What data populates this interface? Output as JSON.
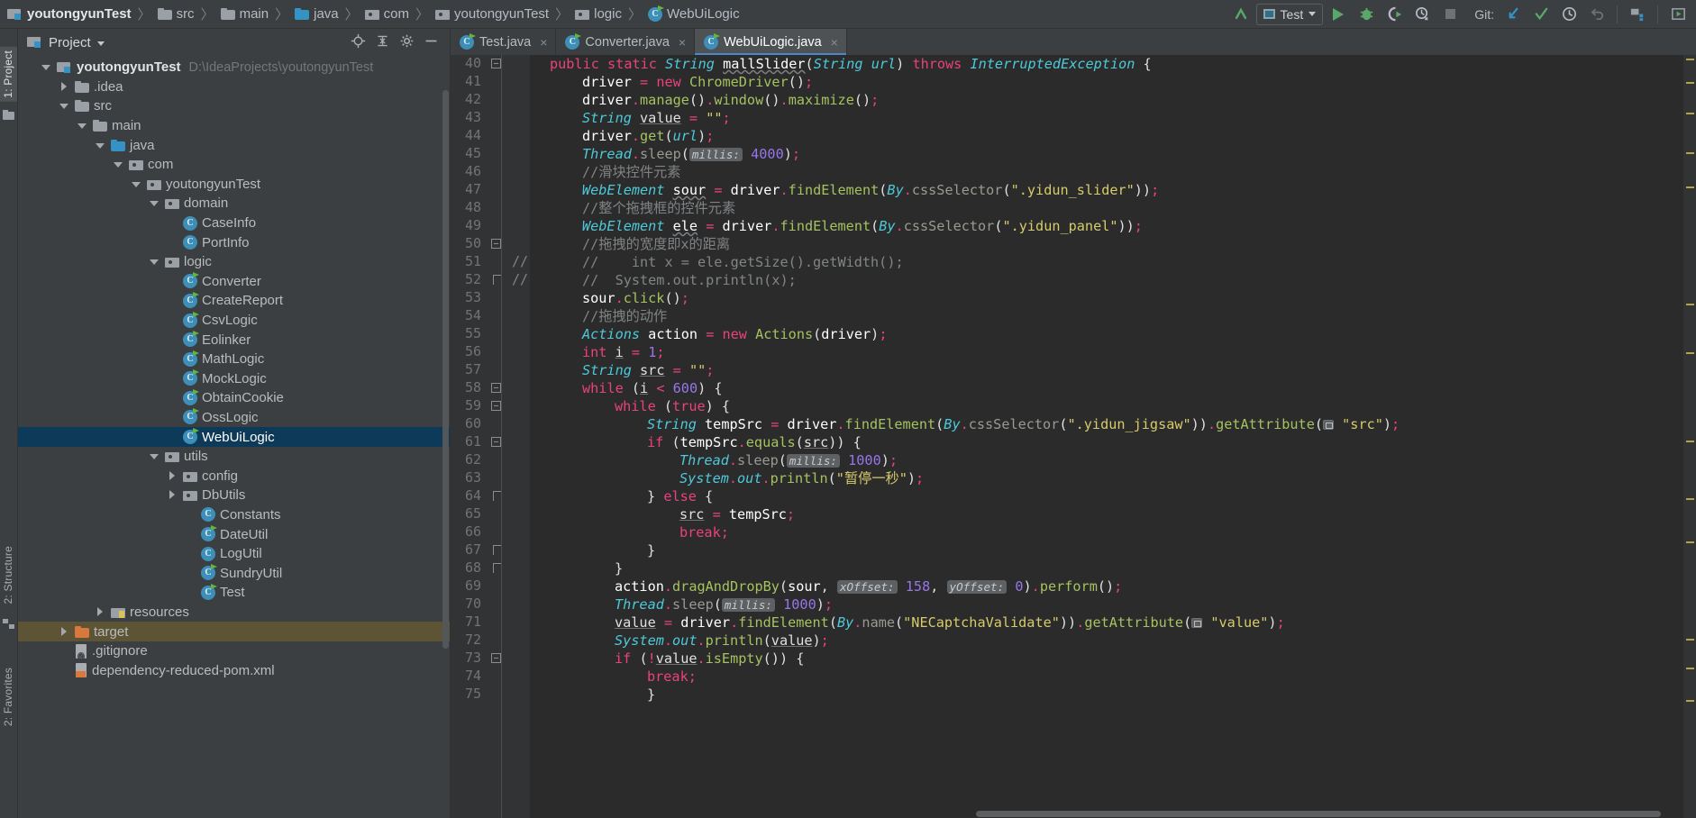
{
  "breadcrumb": {
    "items": [
      {
        "label": "youtongyunTest",
        "icon": "project-icon",
        "kind": "project"
      },
      {
        "label": "src",
        "icon": "folder-icon",
        "kind": "folder"
      },
      {
        "label": "main",
        "icon": "folder-icon",
        "kind": "folder"
      },
      {
        "label": "java",
        "icon": "source-folder-icon",
        "kind": "source"
      },
      {
        "label": "com",
        "icon": "package-icon",
        "kind": "package"
      },
      {
        "label": "youtongyunTest",
        "icon": "package-icon",
        "kind": "package"
      },
      {
        "label": "logic",
        "icon": "package-icon",
        "kind": "package"
      },
      {
        "label": "WebUiLogic",
        "icon": "java-class-icon",
        "kind": "class"
      }
    ],
    "separator": "〉"
  },
  "toolbar": {
    "back_arrow": "back-arrow-icon",
    "run_config": "Test",
    "run": "run-icon",
    "debug": "debug-icon",
    "run_coverage": "run-with-coverage-icon",
    "profile": "profiler-icon",
    "stop": "stop-icon",
    "git_label": "Git:",
    "git_update": "update-project-icon",
    "git_commit": "commit-icon",
    "git_history": "history-icon",
    "git_rollback": "rollback-icon",
    "project_structure": "project-structure-icon",
    "search_everywhere": "select-opened-file-icon"
  },
  "left_strip": {
    "project_tab": "1: Project",
    "structure_tab": "2: Structure",
    "favorites_tab": "2: Favorites"
  },
  "project_panel": {
    "title": "Project",
    "actions": [
      "locate-icon",
      "collapse-all-icon",
      "settings-icon",
      "hide-icon"
    ],
    "tree": [
      {
        "depth": 0,
        "arrow": "down",
        "icon": "project-icon",
        "label": "youtongyunTest",
        "path": "D:\\IdeaProjects\\youtongyunTest",
        "bold": true
      },
      {
        "depth": 1,
        "arrow": "right",
        "icon": "folder-icon",
        "label": ".idea"
      },
      {
        "depth": 1,
        "arrow": "down",
        "icon": "folder-icon",
        "label": "src"
      },
      {
        "depth": 2,
        "arrow": "down",
        "icon": "folder-icon",
        "label": "main"
      },
      {
        "depth": 3,
        "arrow": "down",
        "icon": "source-folder-icon",
        "label": "java"
      },
      {
        "depth": 4,
        "arrow": "down",
        "icon": "package-icon",
        "label": "com"
      },
      {
        "depth": 5,
        "arrow": "down",
        "icon": "package-icon",
        "label": "youtongyunTest"
      },
      {
        "depth": 6,
        "arrow": "down",
        "icon": "package-icon",
        "label": "domain"
      },
      {
        "depth": 7,
        "arrow": "none",
        "icon": "java-class-icon",
        "label": "CaseInfo"
      },
      {
        "depth": 7,
        "arrow": "none",
        "icon": "java-class-icon",
        "label": "PortInfo"
      },
      {
        "depth": 6,
        "arrow": "down",
        "icon": "package-icon",
        "label": "logic"
      },
      {
        "depth": 7,
        "arrow": "none",
        "icon": "java-class-runnable-icon",
        "label": "Converter"
      },
      {
        "depth": 7,
        "arrow": "none",
        "icon": "java-class-runnable-icon",
        "label": "CreateReport"
      },
      {
        "depth": 7,
        "arrow": "none",
        "icon": "java-class-runnable-icon",
        "label": "CsvLogic"
      },
      {
        "depth": 7,
        "arrow": "none",
        "icon": "java-class-runnable-icon",
        "label": "Eolinker"
      },
      {
        "depth": 7,
        "arrow": "none",
        "icon": "java-class-runnable-icon",
        "label": "MathLogic"
      },
      {
        "depth": 7,
        "arrow": "none",
        "icon": "java-class-runnable-icon",
        "label": "MockLogic"
      },
      {
        "depth": 7,
        "arrow": "none",
        "icon": "java-class-runnable-icon",
        "label": "ObtainCookie"
      },
      {
        "depth": 7,
        "arrow": "none",
        "icon": "java-class-runnable-icon",
        "label": "OssLogic"
      },
      {
        "depth": 7,
        "arrow": "none",
        "icon": "java-class-runnable-icon",
        "label": "WebUiLogic",
        "selected": true
      },
      {
        "depth": 6,
        "arrow": "down",
        "icon": "package-icon",
        "label": "utils"
      },
      {
        "depth": 7,
        "arrow": "right",
        "icon": "package-icon",
        "label": "config"
      },
      {
        "depth": 7,
        "arrow": "right",
        "icon": "package-icon",
        "label": "DbUtils"
      },
      {
        "depth": 8,
        "arrow": "none",
        "icon": "java-class-icon",
        "label": "Constants"
      },
      {
        "depth": 8,
        "arrow": "none",
        "icon": "java-class-runnable-icon",
        "label": "DateUtil"
      },
      {
        "depth": 8,
        "arrow": "none",
        "icon": "java-class-icon",
        "label": "LogUtil"
      },
      {
        "depth": 8,
        "arrow": "none",
        "icon": "java-class-runnable-icon",
        "label": "SundryUtil"
      },
      {
        "depth": 8,
        "arrow": "none",
        "icon": "java-class-runnable-icon",
        "label": "Test"
      },
      {
        "depth": 3,
        "arrow": "right",
        "icon": "resource-folder-icon",
        "label": "resources"
      },
      {
        "depth": 1,
        "arrow": "right",
        "icon": "target-folder-icon",
        "label": "target",
        "highlight": true
      },
      {
        "depth": 1,
        "arrow": "none",
        "icon": "gitignore-file-icon",
        "label": ".gitignore"
      },
      {
        "depth": 1,
        "arrow": "none",
        "icon": "xml-file-icon",
        "label": "dependency-reduced-pom.xml"
      }
    ]
  },
  "editor": {
    "tabs": [
      {
        "label": "Test.java",
        "icon": "java-class-runnable-icon",
        "active": false,
        "close": "×"
      },
      {
        "label": "Converter.java",
        "icon": "java-class-runnable-icon",
        "active": false,
        "close": "×"
      },
      {
        "label": "WebUiLogic.java",
        "icon": "java-class-runnable-icon",
        "active": true,
        "close": "×"
      }
    ],
    "first_line_number": 40,
    "lines": [
      {
        "n": 40,
        "fold": "minus",
        "indent": 0,
        "html": "<span class=\"kwp\">public</span> <span class=\"kwp\">static</span> <span class=\"ty\">String</span> <span class=\"ident squig\">mallSlider</span><span class=\"punc\">(</span><span class=\"ty\">String</span> <span class=\"ty\">url</span><span class=\"punc\">)</span> <span class=\"kwp\">throws</span> <span class=\"ty\">InterruptedException</span> <span class=\"punc\">{</span>"
      },
      {
        "n": 41,
        "fold": "",
        "indent": 1,
        "html": "<span class=\"ident\">driver</span> <span class=\"semi\">=</span> <span class=\"kwp\">new</span> <span class=\"mth\">ChromeDriver</span><span class=\"punc\">()</span><span class=\"semi\">;</span>"
      },
      {
        "n": 42,
        "fold": "",
        "indent": 1,
        "html": "<span class=\"ident\">driver</span><span class=\"dot\">.</span><span class=\"mth\">manage</span><span class=\"punc\">()</span><span class=\"dot\">.</span><span class=\"mth\">window</span><span class=\"punc\">()</span><span class=\"dot\">.</span><span class=\"mth\">maximize</span><span class=\"punc\">()</span><span class=\"semi\">;</span>"
      },
      {
        "n": 43,
        "fold": "",
        "indent": 1,
        "html": "<span class=\"ty\">String</span> <span class=\"fld\">value</span> <span class=\"semi\">=</span> <span class=\"str\">\"\"</span><span class=\"semi\">;</span>"
      },
      {
        "n": 44,
        "fold": "",
        "indent": 1,
        "html": "<span class=\"ident\">driver</span><span class=\"dot\">.</span><span class=\"mth\">get</span><span class=\"punc\">(</span><span class=\"ty\">url</span><span class=\"punc\">)</span><span class=\"semi\">;</span>"
      },
      {
        "n": 45,
        "fold": "",
        "indent": 1,
        "html": "<span class=\"ty\">Thread</span><span class=\"dot\">.</span><span class=\"mthg\">sleep</span><span class=\"punc\">(</span><span class=\"param\">millis:</span> <span class=\"num\">4000</span><span class=\"punc\">)</span><span class=\"semi\">;</span>"
      },
      {
        "n": 46,
        "fold": "",
        "indent": 1,
        "html": "<span class=\"cmt\">//滑块控件元素</span>"
      },
      {
        "n": 47,
        "fold": "",
        "indent": 1,
        "html": "<span class=\"ty\">WebElement</span> <span class=\"ident squig\">sour</span> <span class=\"semi\">=</span> <span class=\"ident\">driver</span><span class=\"dot\">.</span><span class=\"mth\">findElement</span><span class=\"punc\">(</span><span class=\"ty\">By</span><span class=\"dot\">.</span><span class=\"mthg\">cssSelector</span><span class=\"punc\">(</span><span class=\"str\">\".yidun_slider\"</span><span class=\"punc\">))</span><span class=\"semi\">;</span>"
      },
      {
        "n": 48,
        "fold": "",
        "indent": 1,
        "html": "<span class=\"cmt\">//整个拖拽框的控件元素</span>"
      },
      {
        "n": 49,
        "fold": "",
        "indent": 1,
        "html": "<span class=\"ty\">WebElement</span> <span class=\"ident squig\">ele</span> <span class=\"semi\">=</span> <span class=\"ident\">driver</span><span class=\"dot\">.</span><span class=\"mth\">findElement</span><span class=\"punc\">(</span><span class=\"ty\">By</span><span class=\"dot\">.</span><span class=\"mthg\">cssSelector</span><span class=\"punc\">(</span><span class=\"str\">\".yidun_panel\"</span><span class=\"punc\">))</span><span class=\"semi\">;</span>"
      },
      {
        "n": 50,
        "fold": "minus",
        "indent": 1,
        "html": "<span class=\"cmt\">//拖拽的宽度即x的距离</span>"
      },
      {
        "n": 51,
        "fold": "",
        "indent": 1,
        "prefix": "//",
        "html": "<span class=\"cmtline\">    int x = ele.getSize().getWidth();</span>"
      },
      {
        "n": 52,
        "fold": "end",
        "indent": 1,
        "prefix": "//",
        "html": "<span class=\"cmtline\">  System.out.println(x);</span>"
      },
      {
        "n": 53,
        "fold": "",
        "indent": 1,
        "html": "<span class=\"ident\">sour</span><span class=\"dot\">.</span><span class=\"mth\">click</span><span class=\"punc\">()</span><span class=\"semi\">;</span>"
      },
      {
        "n": 54,
        "fold": "",
        "indent": 1,
        "html": "<span class=\"cmt\">//拖拽的动作</span>"
      },
      {
        "n": 55,
        "fold": "",
        "indent": 1,
        "html": "<span class=\"ty\">Actions</span> <span class=\"ident\">action</span> <span class=\"semi\">=</span> <span class=\"kwp\">new</span> <span class=\"mth\">Actions</span><span class=\"punc\">(</span><span class=\"ident\">driver</span><span class=\"punc\">)</span><span class=\"semi\">;</span>"
      },
      {
        "n": 56,
        "fold": "",
        "indent": 1,
        "html": "<span class=\"kwp\">int</span> <span class=\"fld\">i</span> <span class=\"semi\">=</span> <span class=\"num\">1</span><span class=\"semi\">;</span>"
      },
      {
        "n": 57,
        "fold": "",
        "indent": 1,
        "html": "<span class=\"ty\">String</span> <span class=\"fld\">src</span> <span class=\"semi\">=</span> <span class=\"str\">\"\"</span><span class=\"semi\">;</span>"
      },
      {
        "n": 58,
        "fold": "minus",
        "indent": 1,
        "html": "<span class=\"kwp\">while</span> <span class=\"punc\">(</span><span class=\"fld\">i</span> <span class=\"semi\">&lt;</span> <span class=\"num\">600</span><span class=\"punc\">) {</span>"
      },
      {
        "n": 59,
        "fold": "minus",
        "indent": 2,
        "html": "<span class=\"kwp\">while</span> <span class=\"punc\">(</span><span class=\"kwp\">true</span><span class=\"punc\">) {</span>"
      },
      {
        "n": 60,
        "fold": "",
        "indent": 3,
        "html": "<span class=\"ty\">String</span> <span class=\"ident\">tempSrc</span> <span class=\"semi\">=</span> <span class=\"ident\">driver</span><span class=\"dot\">.</span><span class=\"mth\">findElement</span><span class=\"punc\">(</span><span class=\"ty\">By</span><span class=\"dot\">.</span><span class=\"mthg\">cssSelector</span><span class=\"punc\">(</span><span class=\"str\">\".yidun_jigsaw\"</span><span class=\"punc\">))</span><span class=\"dot\">.</span><span class=\"mth\">getAttribute</span><span class=\"punc\">(</span><span class=\"sq-ic\"></span> <span class=\"str\">\"src\"</span><span class=\"punc\">)</span><span class=\"semi\">;</span>"
      },
      {
        "n": 61,
        "fold": "minus",
        "indent": 3,
        "html": "<span class=\"kwp\">if</span> <span class=\"punc\">(</span><span class=\"ident\">tempSrc</span><span class=\"dot\">.</span><span class=\"mth\">equals</span><span class=\"punc\">(</span><span class=\"fld\">src</span><span class=\"punc\">)) {</span>"
      },
      {
        "n": 62,
        "fold": "",
        "indent": 4,
        "html": "<span class=\"ty\">Thread</span><span class=\"dot\">.</span><span class=\"mthg\">sleep</span><span class=\"punc\">(</span><span class=\"param\">millis:</span> <span class=\"num\">1000</span><span class=\"punc\">)</span><span class=\"semi\">;</span>"
      },
      {
        "n": 63,
        "fold": "",
        "indent": 4,
        "html": "<span class=\"ty\">System</span><span class=\"dot\">.</span><span class=\"ty\">out</span><span class=\"dot\">.</span><span class=\"mth\">println</span><span class=\"punc\">(</span><span class=\"str\">\"暂停一秒\"</span><span class=\"punc\">)</span><span class=\"semi\">;</span>"
      },
      {
        "n": 64,
        "fold": "end",
        "indent": 3,
        "html": "<span class=\"punc\">}</span> <span class=\"kwp\">else</span> <span class=\"punc\">{</span>"
      },
      {
        "n": 65,
        "fold": "",
        "indent": 4,
        "html": "<span class=\"fld\">src</span> <span class=\"semi\">=</span> <span class=\"ident\">tempSrc</span><span class=\"semi\">;</span>"
      },
      {
        "n": 66,
        "fold": "",
        "indent": 4,
        "html": "<span class=\"kwp\">break</span><span class=\"semi\">;</span>"
      },
      {
        "n": 67,
        "fold": "end",
        "indent": 3,
        "html": "<span class=\"punc\">}</span>"
      },
      {
        "n": 68,
        "fold": "end",
        "indent": 2,
        "html": "<span class=\"punc\">}</span>"
      },
      {
        "n": 69,
        "fold": "",
        "indent": 2,
        "html": "<span class=\"ident\">action</span><span class=\"dot\">.</span><span class=\"mth\">dragAndDropBy</span><span class=\"punc\">(</span><span class=\"ident\">sour</span><span class=\"punc\">,</span> <span class=\"param\">xOffset:</span> <span class=\"num\">158</span><span class=\"punc\">,</span> <span class=\"param\">yOffset:</span> <span class=\"num\">0</span><span class=\"punc\">)</span><span class=\"dot\">.</span><span class=\"mth\">perform</span><span class=\"punc\">()</span><span class=\"semi\">;</span>"
      },
      {
        "n": 70,
        "fold": "",
        "indent": 2,
        "html": "<span class=\"ty\">Thread</span><span class=\"dot\">.</span><span class=\"mthg\">sleep</span><span class=\"punc\">(</span><span class=\"param\">millis:</span> <span class=\"num\">1000</span><span class=\"punc\">)</span><span class=\"semi\">;</span>"
      },
      {
        "n": 71,
        "fold": "",
        "indent": 2,
        "html": "<span class=\"fld\">value</span> <span class=\"semi\">=</span> <span class=\"ident\">driver</span><span class=\"dot\">.</span><span class=\"mth\">findElement</span><span class=\"punc\">(</span><span class=\"ty\">By</span><span class=\"dot\">.</span><span class=\"mthg\">name</span><span class=\"punc\">(</span><span class=\"str\">\"NECaptchaValidate\"</span><span class=\"punc\">))</span><span class=\"dot\">.</span><span class=\"mth\">getAttribute</span><span class=\"punc\">(</span><span class=\"sq-ic\"></span> <span class=\"str\">\"value\"</span><span class=\"punc\">)</span><span class=\"semi\">;</span>"
      },
      {
        "n": 72,
        "fold": "",
        "indent": 2,
        "html": "<span class=\"ty\">System</span><span class=\"dot\">.</span><span class=\"ty\">out</span><span class=\"dot\">.</span><span class=\"mth\">println</span><span class=\"punc\">(</span><span class=\"fld\">value</span><span class=\"punc\">)</span><span class=\"semi\">;</span>"
      },
      {
        "n": 73,
        "fold": "minus",
        "indent": 2,
        "html": "<span class=\"kwp\">if</span> <span class=\"punc\">(</span><span class=\"semi\">!</span><span class=\"fld\">value</span><span class=\"dot\">.</span><span class=\"mth\">isEmpty</span><span class=\"punc\">()) {</span>"
      },
      {
        "n": 74,
        "fold": "",
        "indent": 3,
        "html": "<span class=\"kwp\">break</span><span class=\"semi\">;</span>"
      },
      {
        "n": 75,
        "fold": "",
        "indent": 3,
        "html": "<span class=\"punc\">}</span>"
      }
    ]
  },
  "colors": {
    "accent": "#4a88c7",
    "selection": "#0d3a58",
    "editor_bg": "#2b2b2b",
    "panel_bg": "#3c3f41",
    "gutter_bg": "#313335",
    "keyword": "#e8437f",
    "type": "#4ec9d9",
    "string": "#d7cb6b",
    "number": "#9876ea",
    "method": "#a5c261",
    "comment": "#7f8385",
    "run_green": "#59a869",
    "target_highlight": "#5c5434"
  }
}
